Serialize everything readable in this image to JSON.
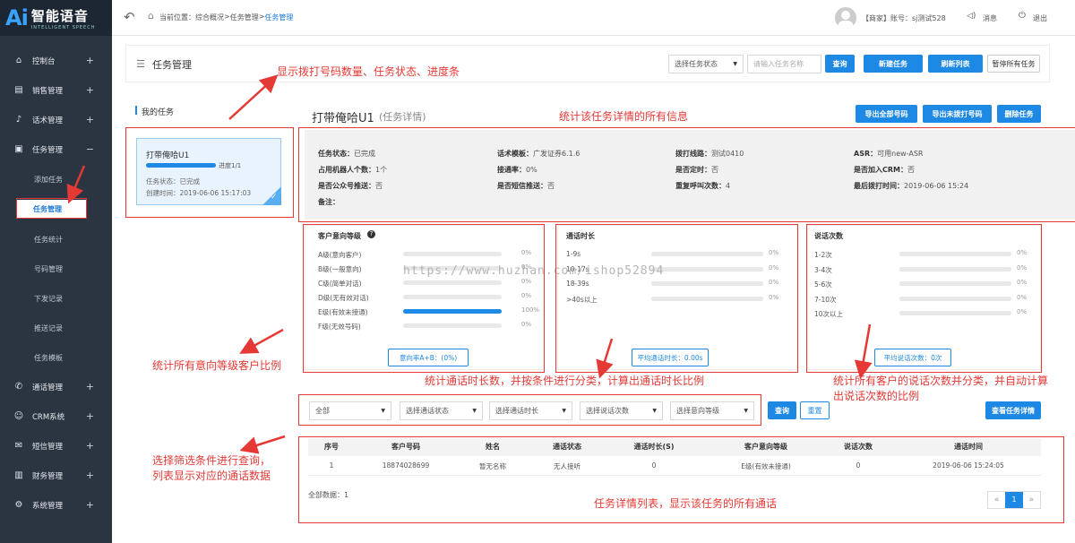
{
  "logo": {
    "ai": "Ai",
    "name": "智能语音",
    "sub": "INTELLIGENT SPEECH"
  },
  "sidebar": {
    "items": [
      {
        "label": "控制台",
        "toggle": "+"
      },
      {
        "label": "销售管理",
        "toggle": "+"
      },
      {
        "label": "话术管理",
        "toggle": "+"
      },
      {
        "label": "任务管理",
        "toggle": "−"
      },
      {
        "label": "通话管理",
        "toggle": "+"
      },
      {
        "label": "CRM系统",
        "toggle": "+"
      },
      {
        "label": "短信管理",
        "toggle": "+"
      },
      {
        "label": "财务管理",
        "toggle": "+"
      },
      {
        "label": "系统管理",
        "toggle": "+"
      }
    ],
    "subitems": [
      "添加任务",
      "任务管理",
      "任务统计",
      "号码管理",
      "下发记录",
      "推送记录",
      "任务模板"
    ]
  },
  "topbar": {
    "crumb_prefix": "当前位置：",
    "crumbs": [
      "综合概况",
      "任务管理",
      "任务管理"
    ],
    "seps": [
      " > ",
      " > "
    ],
    "account": "【商家】账号：sj测试528",
    "message": "消息",
    "logout": "退出"
  },
  "page": {
    "title": "任务管理",
    "status_select": "选择任务状态",
    "task_name_placeholder": "请输入任务名称",
    "query": "查询",
    "new_task": "新建任务",
    "refresh": "刷新列表",
    "pause_all": "暂停所有任务"
  },
  "my_tasks": {
    "heading": "我的任务",
    "card": {
      "name": "打带俺哈U1",
      "progress_label": "进度1/1",
      "progress": 1.0,
      "status": "任务状态：已完成",
      "created": "创建时间：2019-06-06 15:17:03"
    }
  },
  "detail": {
    "title": "打带俺哈U1",
    "subtitle": "(任务详情)",
    "export_all": "导出全部号码",
    "export_undialed": "导出未拨打号码",
    "delete": "删除任务",
    "fields": [
      {
        "k": "任务状态：",
        "v": "已完成"
      },
      {
        "k": "话术模板：",
        "v": "广发证券6.1.6"
      },
      {
        "k": "拨打线路：",
        "v": "测试0410"
      },
      {
        "k": "ASR：",
        "v": "可用new-ASR"
      },
      {
        "k": "占用机器人个数：",
        "v": "1个"
      },
      {
        "k": "接通率：",
        "v": "0%"
      },
      {
        "k": "是否定时：",
        "v": "否"
      },
      {
        "k": "是否加入CRM：",
        "v": "否"
      },
      {
        "k": "是否公众号推送：",
        "v": "否"
      },
      {
        "k": "是否短信推送：",
        "v": "否"
      },
      {
        "k": "重复呼叫次数：",
        "v": "4"
      },
      {
        "k": "最后拨打时间：",
        "v": "2019-06-06 15:24"
      },
      {
        "k": "备注：",
        "v": ""
      }
    ]
  },
  "intent": {
    "title": "客户意向等级",
    "rows": [
      {
        "label": "A级(意向客户)",
        "pct": "0%",
        "value": 0
      },
      {
        "label": "B级(一般意向)",
        "pct": "0%",
        "value": 0
      },
      {
        "label": "C级(简单对话)",
        "pct": "0%",
        "value": 0
      },
      {
        "label": "D级(无有效对话)",
        "pct": "0%",
        "value": 0
      },
      {
        "label": "E级(有效未接通)",
        "pct": "100%",
        "value": 100
      },
      {
        "label": "F级(无效号码)",
        "pct": "0%",
        "value": 0
      }
    ],
    "button": "意向率A+B：(0%)"
  },
  "duration": {
    "title": "通话时长",
    "rows": [
      {
        "label": "1-9s",
        "pct": "0%",
        "value": 0
      },
      {
        "label": "10-17s",
        "pct": "0%",
        "value": 0
      },
      {
        "label": "18-39s",
        "pct": "0%",
        "value": 0
      },
      {
        "label": ">40s以上",
        "pct": "0%",
        "value": 0
      }
    ],
    "button": "平均通话时长：0.00s"
  },
  "talks": {
    "title": "说话次数",
    "rows": [
      {
        "label": "1-2次",
        "pct": "0%",
        "value": 0
      },
      {
        "label": "3-4次",
        "pct": "0%",
        "value": 0
      },
      {
        "label": "5-6次",
        "pct": "0%",
        "value": 0
      },
      {
        "label": "7-10次",
        "pct": "0%",
        "value": 0
      },
      {
        "label": "10次以上",
        "pct": "0%",
        "value": 0
      }
    ],
    "button": "平均说话次数：0次"
  },
  "watermark": "https://www.huzhan.com/ishop52894",
  "filters": {
    "all": "全部",
    "call_status": "选择通话状态",
    "call_duration": "选择通话时长",
    "talk_count": "选择说话次数",
    "intent_level": "选择意向等级",
    "query": "查询",
    "reset": "重置",
    "view_detail": "查看任务详情"
  },
  "table": {
    "headers": [
      "序号",
      "客户号码",
      "姓名",
      "通话状态",
      "通话时长(S)",
      "客户意向等级",
      "说话次数",
      "通话时间"
    ],
    "rows": [
      [
        "1",
        "18874028699",
        "暂无名称",
        "无人接听",
        "0",
        "E级(有效未接通)",
        "0",
        "2019-06-06 15:24:05"
      ]
    ],
    "total": "全部数据：1",
    "pager": {
      "prev": "«",
      "page": "1",
      "next": "»"
    }
  },
  "annotations": {
    "a1": "显示拨打号码数量、任务状态、进度条",
    "a2": "统计该任务详情的所有信息",
    "a3": "统计所有意向等级客户比例",
    "a4": "统计通话时长数，并按条件进行分类，计算出通话时长比例",
    "a5a": "统计所有客户的说话次数并分类，并自动计算",
    "a5b": "出说话次数的比例",
    "a6a": "选择筛选条件进行查询，",
    "a6b": "列表显示对应的通话数据",
    "a7": "任务详情列表，显示该任务的所有通话"
  },
  "colors": {
    "accent": "#1e88e5",
    "annotation": "#e53935",
    "sidebar": "#2a3541"
  }
}
